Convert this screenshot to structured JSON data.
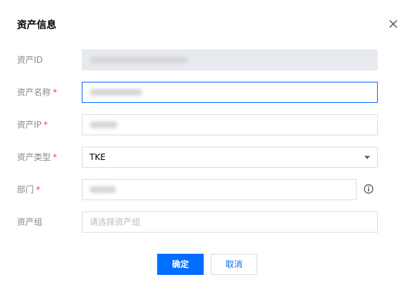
{
  "dialog": {
    "title": "资产信息",
    "close_icon": "close-icon"
  },
  "form": {
    "asset_id": {
      "label": "资产ID",
      "required": false,
      "value": ""
    },
    "asset_name": {
      "label": "资产名称",
      "required": true,
      "required_mark": "*",
      "value": ""
    },
    "asset_ip": {
      "label": "资产IP",
      "required": true,
      "required_mark": "*",
      "value": ""
    },
    "asset_type": {
      "label": "资产类型",
      "required": true,
      "required_mark": "*",
      "value": "TKE",
      "icon": "chevron-down-icon"
    },
    "department": {
      "label": "部门",
      "required": true,
      "required_mark": "*",
      "value": "",
      "icon": "info-icon"
    },
    "asset_group": {
      "label": "资产组",
      "required": false,
      "placeholder": "请选择资产组"
    }
  },
  "buttons": {
    "confirm": "确定",
    "cancel": "取消"
  },
  "colors": {
    "primary": "#006eff",
    "required": "#e54545",
    "disabled_bg": "#e7eaef"
  }
}
